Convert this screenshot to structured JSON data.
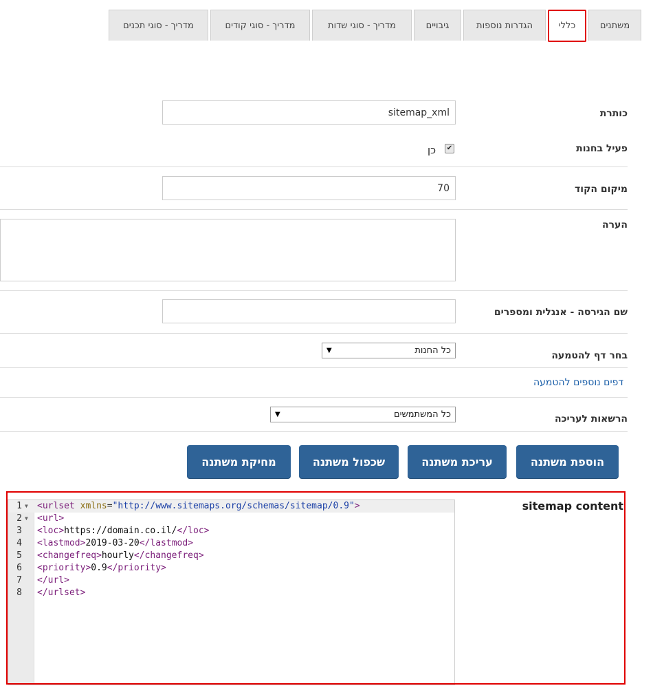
{
  "tabs": [
    {
      "label": "משתנים",
      "active": false
    },
    {
      "label": "כללי",
      "active": true
    },
    {
      "label": "הגדרות נוספות",
      "active": false
    },
    {
      "label": "גיבויים",
      "active": false
    },
    {
      "label": "מדריך - סוגי שדות",
      "active": false
    },
    {
      "label": "מדריך - סוגי קודים",
      "active": false
    },
    {
      "label": "מדריך - סוגי תכנים",
      "active": false
    }
  ],
  "form": {
    "title_label": "כותרת",
    "title_value": "sitemap_xml",
    "active_label": "פעיל בחנות",
    "active_checked": true,
    "active_option": "כן",
    "position_label": "מיקום הקוד",
    "position_value": "70",
    "note_label": "הערה",
    "note_value": "",
    "version_label": "שם הגירסה - אנגלית ומספרים",
    "version_value": "",
    "page_label": "בחר דף להטמעה",
    "page_selected": "כל החנות",
    "more_pages_link": "דפים נוספים להטמעה",
    "permissions_label": "הרשאות לעריכה",
    "permissions_selected": "כל המשתמשים"
  },
  "buttons": {
    "add": "הוספת משתנה",
    "edit": "עריכת משתנה",
    "duplicate": "שכפול משתנה",
    "delete": "מחיקת משתנה"
  },
  "editor": {
    "label": "sitemap content",
    "lines": [
      "<urlset xmlns=\"http://www.sitemaps.org/schemas/sitemap/0.9\">",
      "<url>",
      "<loc>https://domain.co.il/</loc>",
      "<lastmod>2019-03-20</lastmod>",
      "<changefreq>hourly</changefreq>",
      "<priority>0.9</priority>",
      "</url>",
      "</urlset>"
    ],
    "line_numbers": [
      "1",
      "2",
      "3",
      "4",
      "5",
      "6",
      "7",
      "8"
    ]
  },
  "colors": {
    "button_bg": "#2f6397",
    "highlight": "#e00000",
    "link": "#1a5ea8",
    "xml_tag": "#7b1e7a",
    "xml_attr": "#8a6d12",
    "xml_string": "#1a3fa6"
  }
}
